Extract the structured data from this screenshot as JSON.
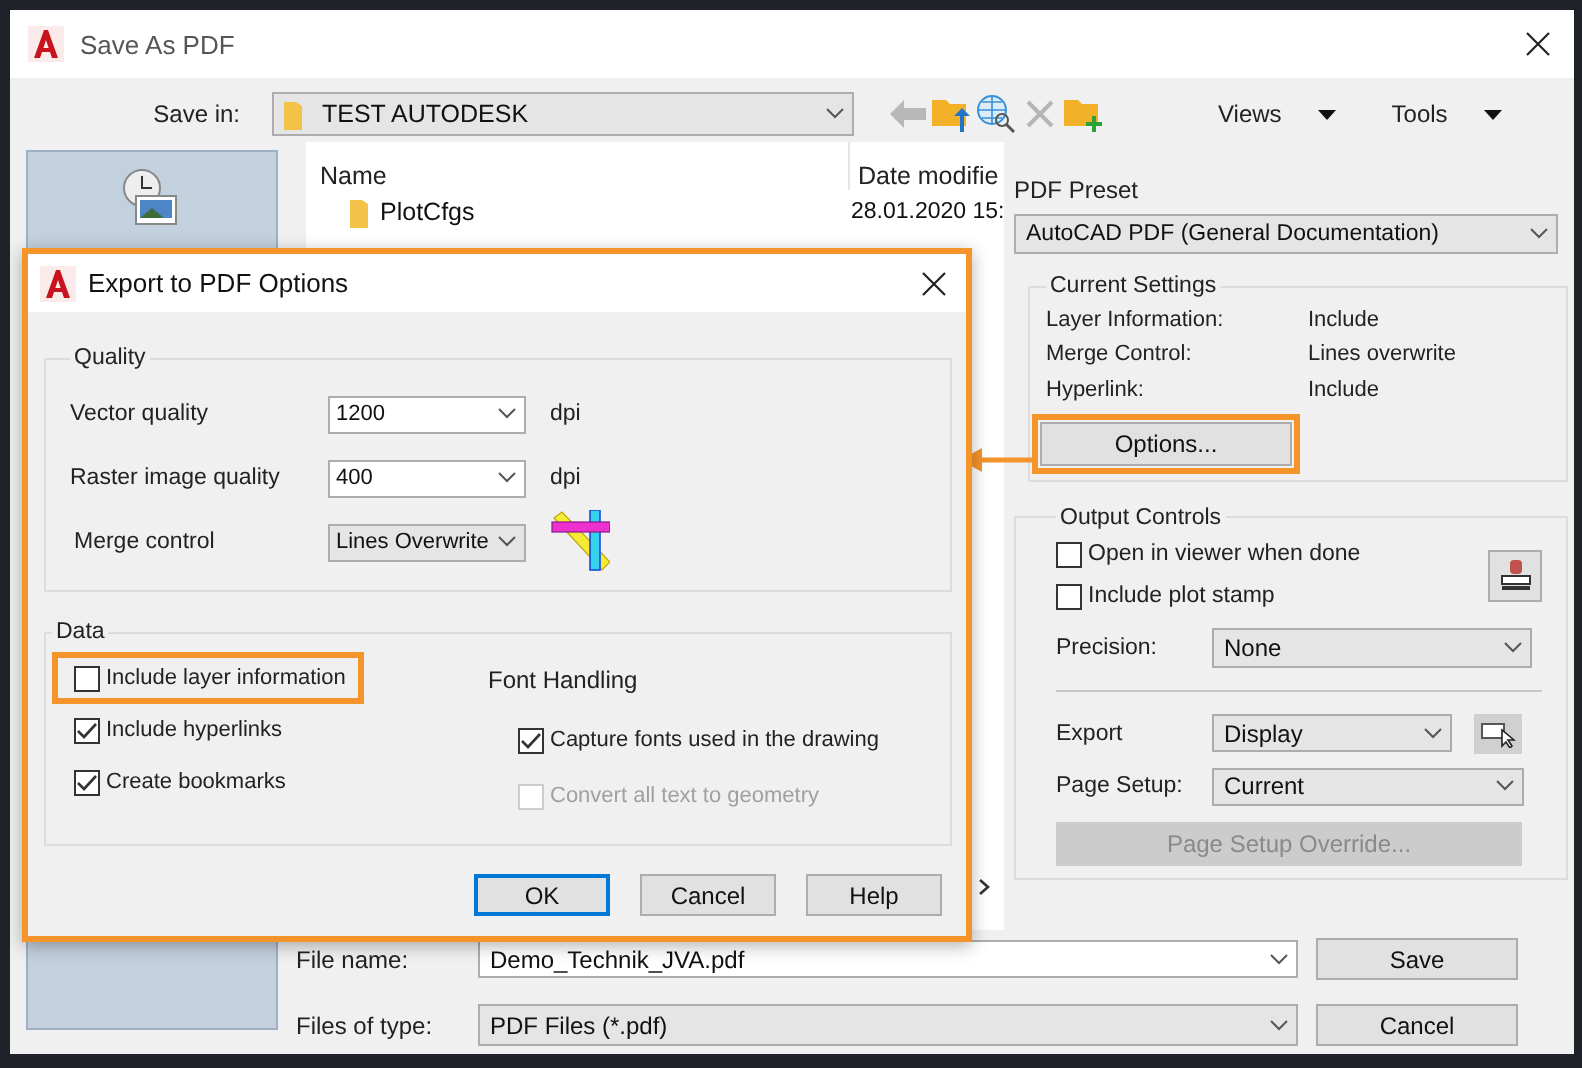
{
  "window": {
    "title": "Save As PDF"
  },
  "toolbar": {
    "save_in_label": "Save in:",
    "save_in_value": "TEST AUTODESK",
    "menus": [
      "Views",
      "Tools"
    ]
  },
  "file_list": {
    "columns": [
      "Name",
      "Date modifie"
    ],
    "rows": [
      {
        "name": "PlotCfgs",
        "date": "28.01.2020 15:"
      }
    ]
  },
  "pdf_preset": {
    "label": "PDF Preset",
    "value": "AutoCAD PDF (General Documentation)"
  },
  "current_settings": {
    "title": "Current Settings",
    "rows": [
      {
        "label": "Layer Information:",
        "value": "Include"
      },
      {
        "label": "Merge Control:",
        "value": "Lines overwrite"
      },
      {
        "label": "Hyperlink:",
        "value": "Include"
      }
    ],
    "options_button": {
      "label": "Options...",
      "highlighted": true
    }
  },
  "output_controls": {
    "title": "Output Controls",
    "checkboxes": [
      {
        "label": "Open in viewer when done",
        "checked": false
      },
      {
        "label": "Include plot stamp",
        "checked": false
      }
    ],
    "precision": {
      "label": "Precision:",
      "value": "None"
    },
    "export": {
      "label": "Export",
      "value": "Display"
    },
    "page_setup": {
      "label": "Page Setup:",
      "value": "Current"
    },
    "override_button": {
      "label": "Page Setup Override...",
      "disabled": true
    }
  },
  "file_name": {
    "label": "File name:",
    "value": "Demo_Technik_JVA.pdf"
  },
  "file_type": {
    "label": "Files of type:",
    "value": "PDF Files (*.pdf)"
  },
  "buttons": [
    "Save",
    "Cancel"
  ],
  "export_dialog": {
    "title": "Export to PDF Options",
    "highlighted": true,
    "quality": {
      "title": "Quality",
      "rows": [
        {
          "kind": "combo",
          "label": "Vector quality",
          "value": "1200",
          "unit": "dpi"
        },
        {
          "kind": "combo",
          "label": "Raster image quality",
          "value": "400",
          "unit": "dpi"
        },
        {
          "kind": "dropdown",
          "label": "Merge control",
          "value": "Lines Overwrite"
        }
      ]
    },
    "data": {
      "title": "Data",
      "options": [
        {
          "label": "Include layer information",
          "checked": false,
          "highlighted": true
        },
        {
          "label": "Include hyperlinks",
          "checked": true,
          "highlighted": false
        },
        {
          "label": "Create bookmarks",
          "checked": true,
          "highlighted": false
        }
      ],
      "font_title": "Font Handling",
      "font_options": [
        {
          "label": "Capture fonts used in the drawing",
          "checked": true,
          "disabled": false
        },
        {
          "label": "Convert all text to geometry",
          "checked": false,
          "disabled": true
        }
      ]
    },
    "buttons": [
      {
        "label": "OK",
        "default": true
      },
      {
        "label": "Cancel",
        "default": false
      },
      {
        "label": "Help",
        "default": false
      }
    ]
  }
}
